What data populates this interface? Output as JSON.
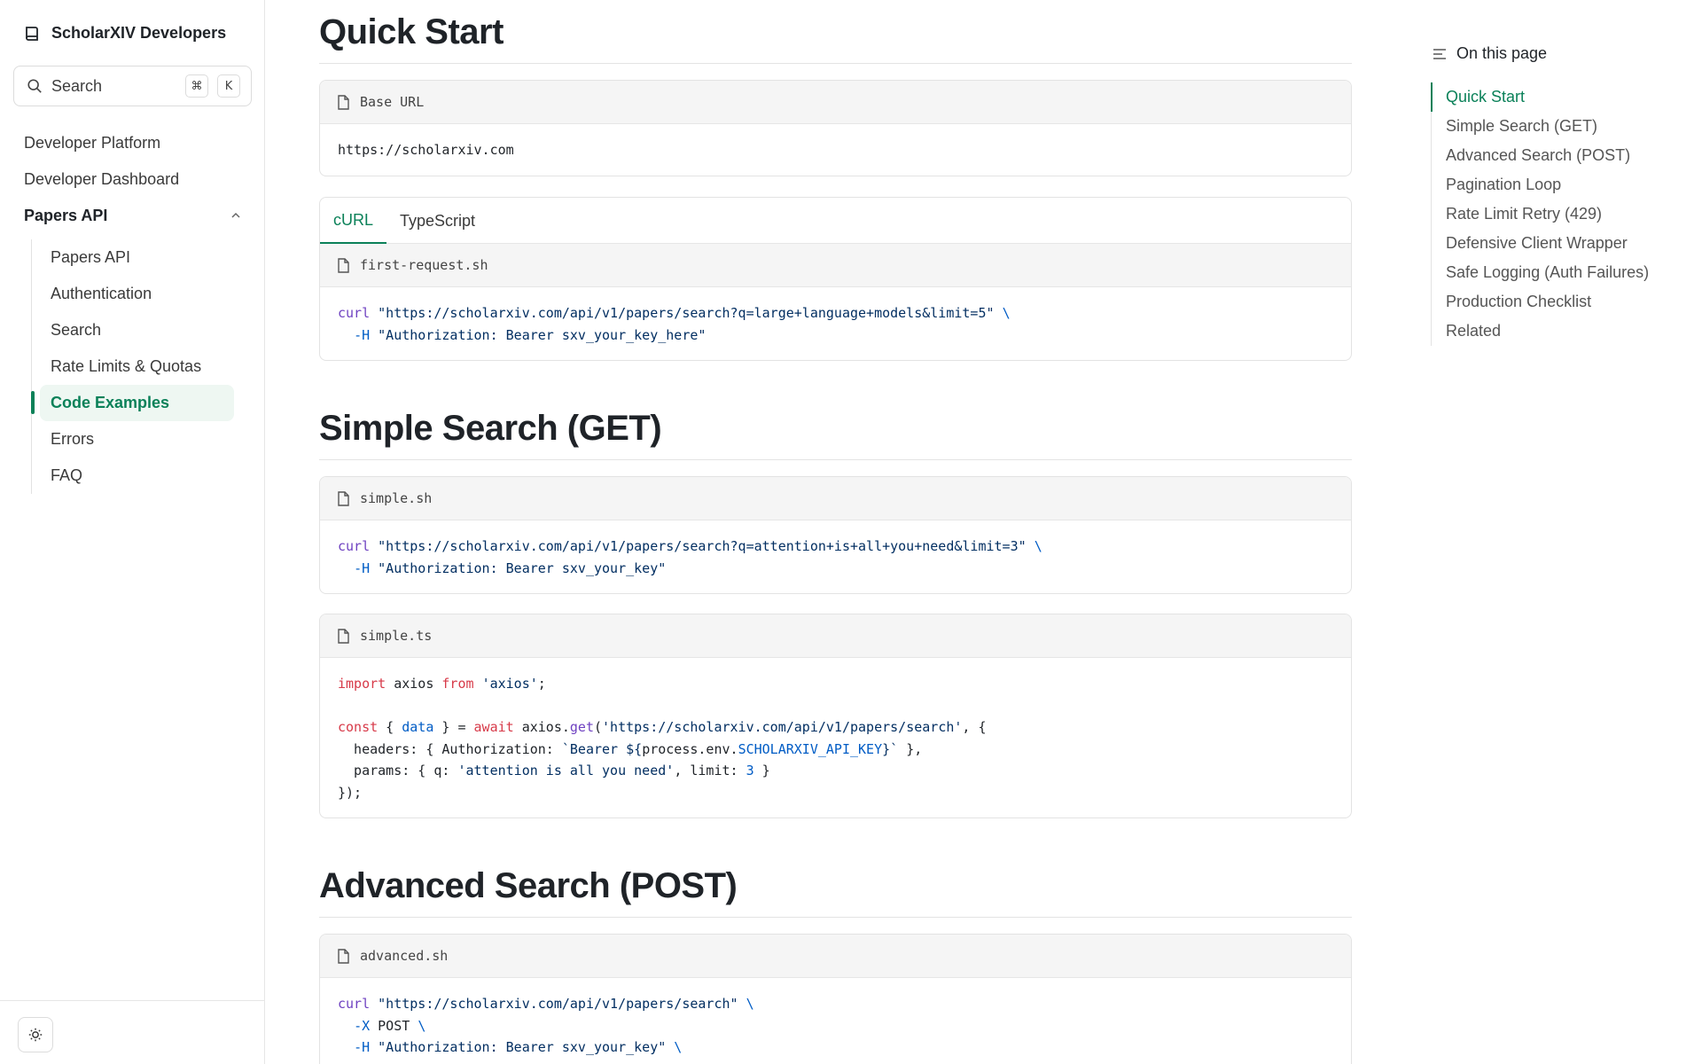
{
  "sidebar": {
    "brand": "ScholarXIV Developers",
    "search_placeholder": "Search",
    "shortcut_mod": "⌘",
    "shortcut_key": "K",
    "top_items": [
      "Developer Platform",
      "Developer Dashboard"
    ],
    "group_label": "Papers API",
    "sub_items": [
      "Papers API",
      "Authentication",
      "Search",
      "Rate Limits & Quotas",
      "Code Examples",
      "Errors",
      "FAQ"
    ],
    "active_sub_item": "Code Examples"
  },
  "main": {
    "quick_start": {
      "title": "Quick Start",
      "base_url_label": "Base URL",
      "base_url": "https://scholarxiv.com",
      "tabs": [
        "cURL",
        "TypeScript"
      ],
      "active_tab": "cURL",
      "file": "first-request.sh",
      "code_line1_cmd": "curl",
      "code_line1_url": "\"https://scholarxiv.com/api/v1/papers/search?q=large+language+models&limit=5\"",
      "code_line2_flag": "-H",
      "code_line2_val": "\"Authorization: Bearer sxv_your_key_here\""
    },
    "simple_search": {
      "title": "Simple Search (GET)",
      "file_sh": "simple.sh",
      "sh_cmd": "curl",
      "sh_url": "\"https://scholarxiv.com/api/v1/papers/search?q=attention+is+all+you+need&limit=3\"",
      "sh_flag": "-H",
      "sh_val": "\"Authorization: Bearer sxv_your_key\"",
      "file_ts": "simple.ts"
    },
    "advanced_search": {
      "title": "Advanced Search (POST)",
      "file": "advanced.sh",
      "cmd": "curl",
      "url": "\"https://scholarxiv.com/api/v1/papers/search\"",
      "flag_x": "-X",
      "method": "POST",
      "flag_h": "-H",
      "auth": "\"Authorization: Bearer sxv_your_key\""
    }
  },
  "toc": {
    "title": "On this page",
    "items": [
      "Quick Start",
      "Simple Search (GET)",
      "Advanced Search (POST)",
      "Pagination Loop",
      "Rate Limit Retry (429)",
      "Defensive Client Wrapper",
      "Safe Logging (Auth Failures)",
      "Production Checklist",
      "Related"
    ],
    "active": "Quick Start"
  },
  "colors": {
    "accent": "#0b8159",
    "code_keyword": "#d73a49",
    "code_string": "#032f62",
    "code_function": "#6f42c1",
    "code_variable": "#005cc5"
  }
}
